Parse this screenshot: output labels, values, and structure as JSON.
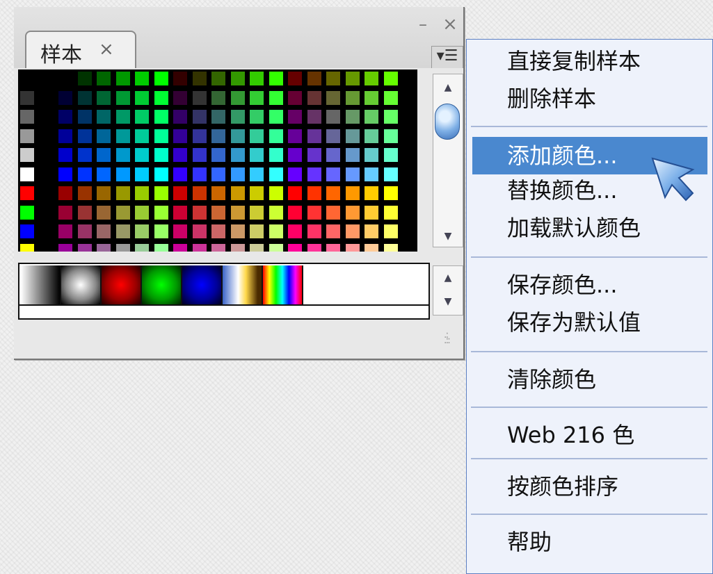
{
  "panel": {
    "tab_label": "样本",
    "tab_close_icon": "close-icon",
    "minimize_icon": "minimize-icon",
    "close_icon": "close-icon",
    "menu_icon": "panel-menu-icon"
  },
  "menu": {
    "items": [
      {
        "label": "直接复制样本"
      },
      {
        "label": "删除样本"
      },
      {
        "label": "添加颜色..."
      },
      {
        "label": "替换颜色..."
      },
      {
        "label": "加载默认颜色"
      },
      {
        "label": "保存颜色..."
      },
      {
        "label": "保存为默认值"
      },
      {
        "label": "清除颜色"
      },
      {
        "label": "Web 216 色"
      },
      {
        "label": "按颜色排序"
      },
      {
        "label": "帮助"
      }
    ],
    "highlighted": "添加颜色..."
  },
  "colors": {
    "menu_highlight": "#4a88cf",
    "menu_bg": "#eef2fb"
  }
}
